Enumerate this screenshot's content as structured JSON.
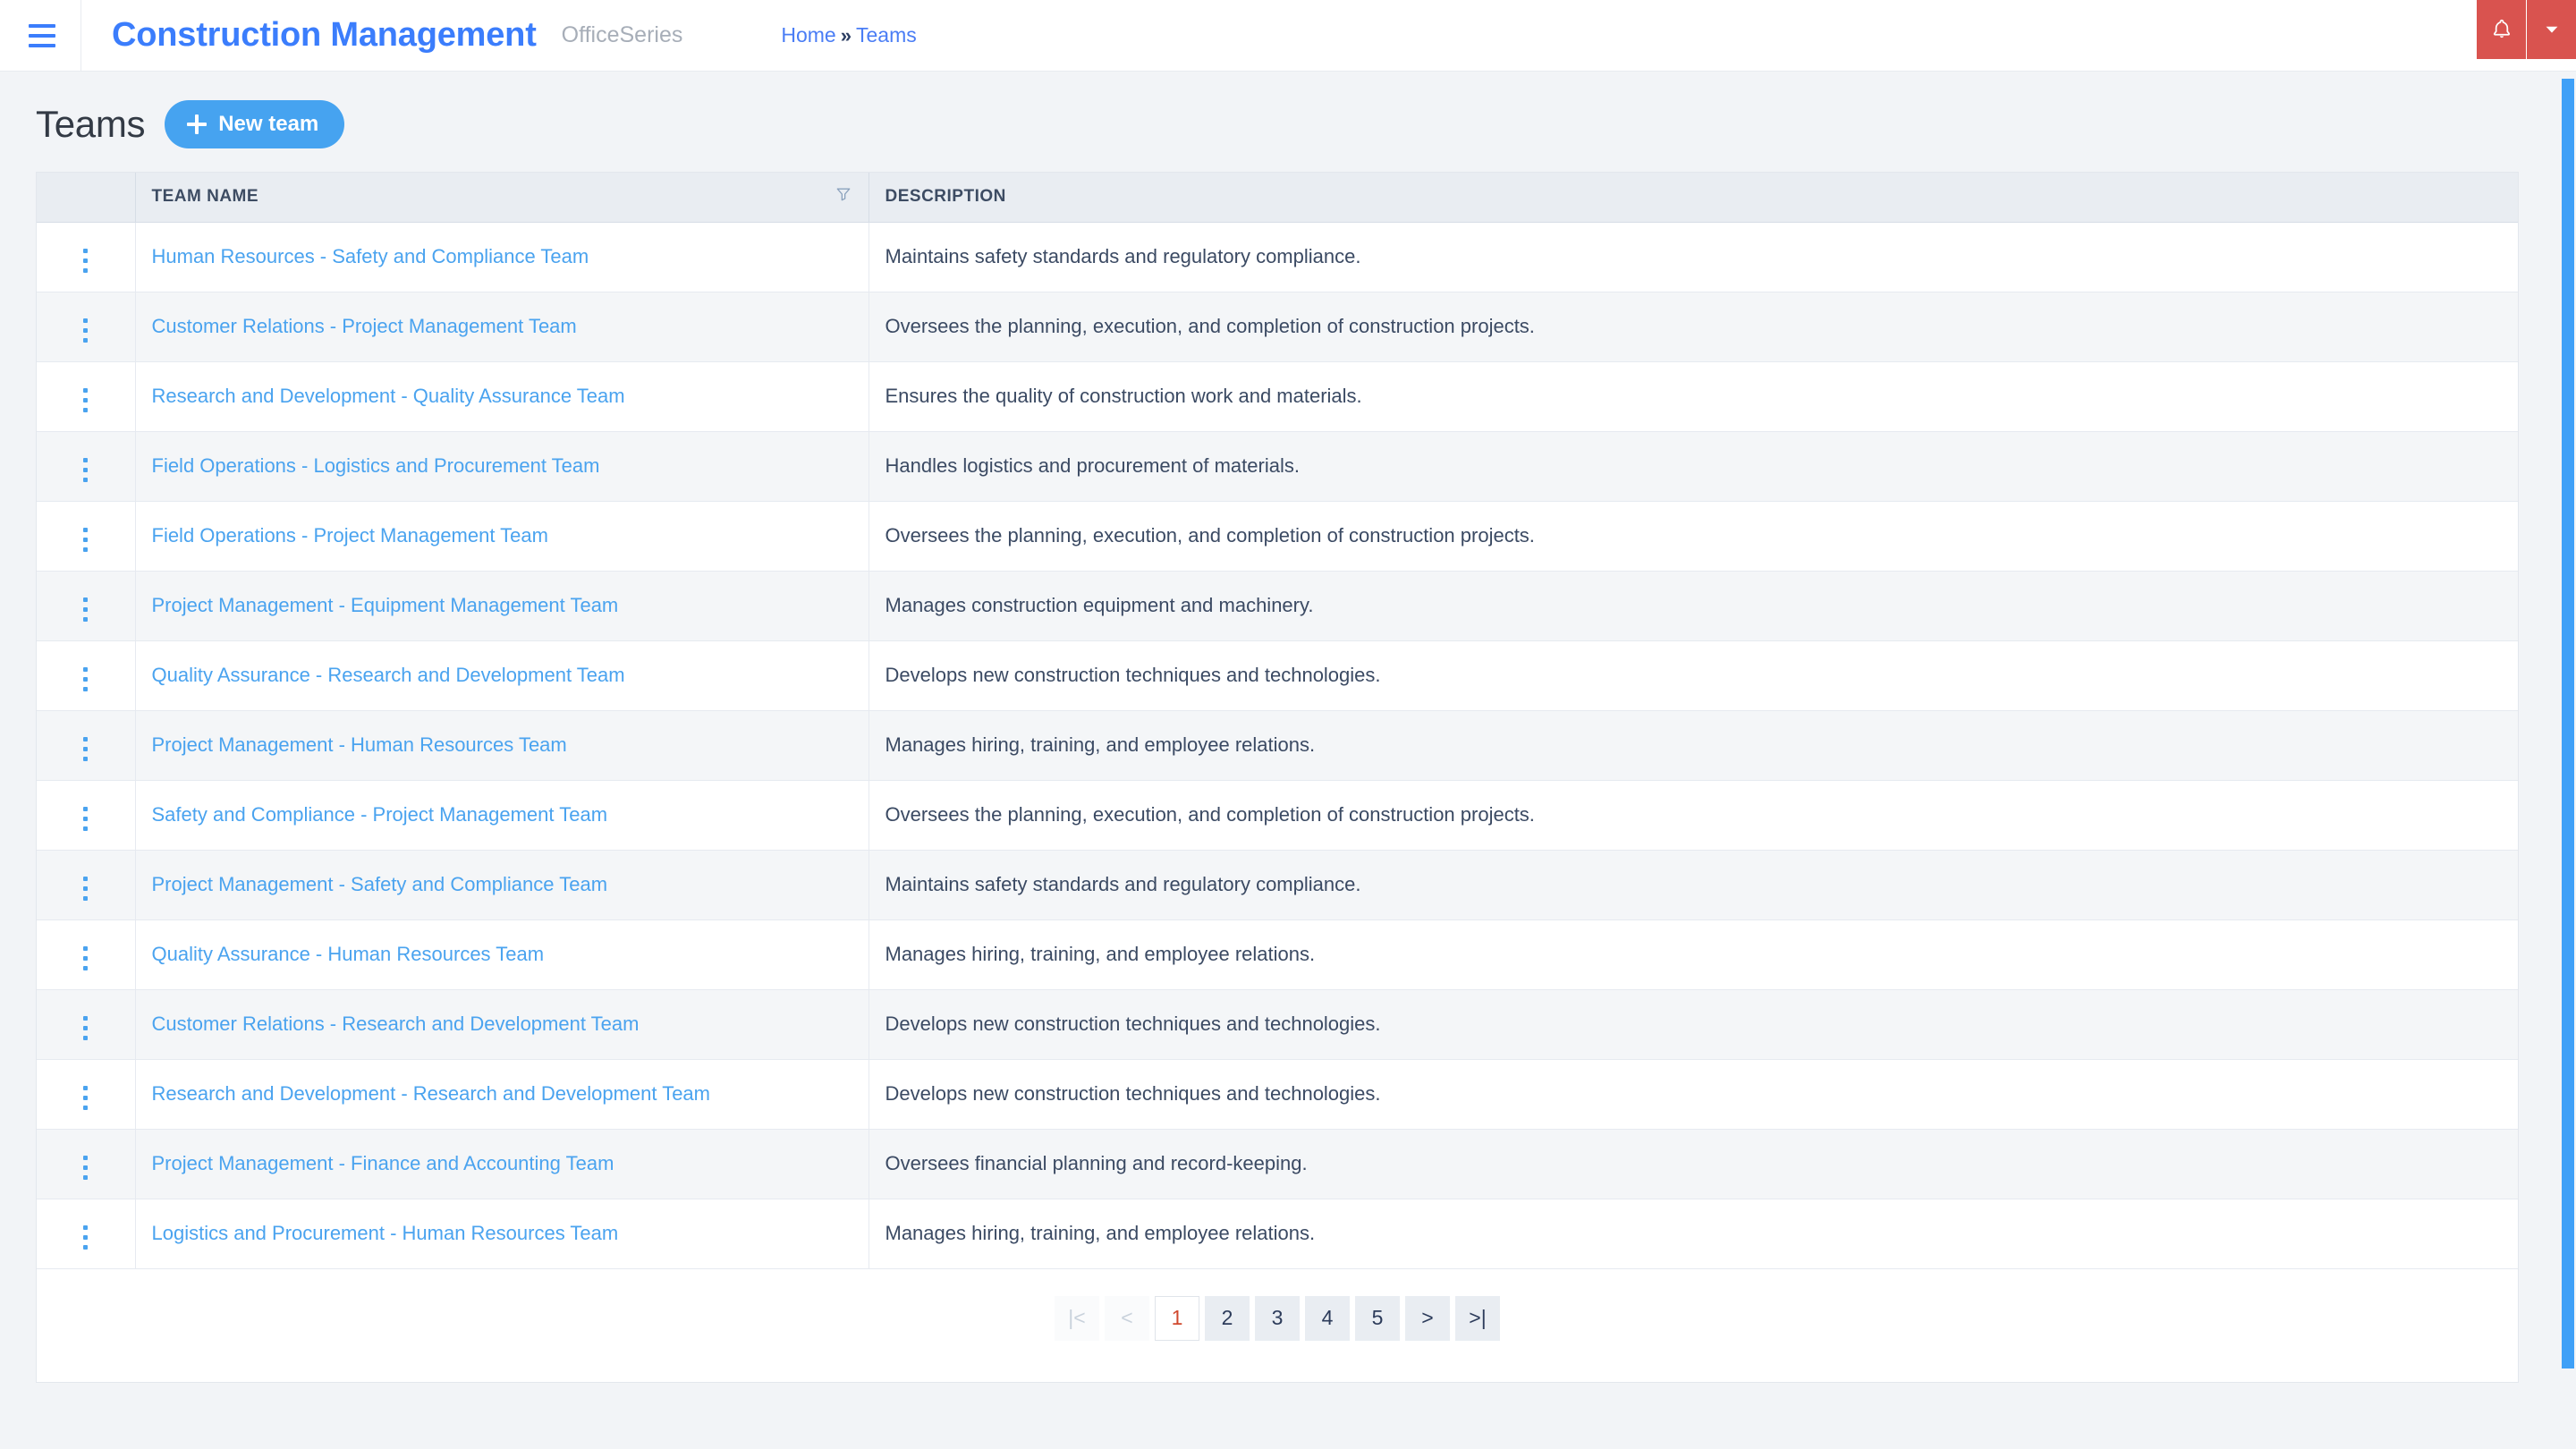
{
  "header": {
    "menu_icon": "hamburger-icon",
    "brand": "Construction Management",
    "brand_sub": "OfficeSeries",
    "breadcrumb": {
      "home": "Home",
      "separator": "»",
      "current": "Teams"
    },
    "notification_icon": "bell-icon",
    "dropdown_icon": "caret-down-icon",
    "accent_color": "#3b7dfc",
    "alert_color": "#d9534f"
  },
  "page": {
    "title": "Teams",
    "new_button_label": "New team",
    "new_button_icon": "plus-icon",
    "new_button_color": "#46a3f0"
  },
  "table": {
    "columns": [
      {
        "key": "actions",
        "label": ""
      },
      {
        "key": "name",
        "label": "TEAM NAME",
        "filter_icon": "funnel-icon"
      },
      {
        "key": "description",
        "label": "DESCRIPTION"
      }
    ],
    "row_action_icon": "kebab-menu-icon",
    "link_color": "#4aa3ef",
    "rows": [
      {
        "name": "Human Resources - Safety and Compliance Team",
        "description": "Maintains safety standards and regulatory compliance."
      },
      {
        "name": "Customer Relations - Project Management Team",
        "description": "Oversees the planning, execution, and completion of construction projects."
      },
      {
        "name": "Research and Development - Quality Assurance Team",
        "description": "Ensures the quality of construction work and materials."
      },
      {
        "name": "Field Operations - Logistics and Procurement Team",
        "description": "Handles logistics and procurement of materials."
      },
      {
        "name": "Field Operations - Project Management Team",
        "description": "Oversees the planning, execution, and completion of construction projects."
      },
      {
        "name": "Project Management - Equipment Management Team",
        "description": "Manages construction equipment and machinery."
      },
      {
        "name": "Quality Assurance - Research and Development Team",
        "description": "Develops new construction techniques and technologies."
      },
      {
        "name": "Project Management - Human Resources Team",
        "description": "Manages hiring, training, and employee relations."
      },
      {
        "name": "Safety and Compliance - Project Management Team",
        "description": "Oversees the planning, execution, and completion of construction projects."
      },
      {
        "name": "Project Management - Safety and Compliance Team",
        "description": "Maintains safety standards and regulatory compliance."
      },
      {
        "name": "Quality Assurance - Human Resources Team",
        "description": "Manages hiring, training, and employee relations."
      },
      {
        "name": "Customer Relations - Research and Development Team",
        "description": "Develops new construction techniques and technologies."
      },
      {
        "name": "Research and Development - Research and Development Team",
        "description": "Develops new construction techniques and technologies."
      },
      {
        "name": "Project Management - Finance and Accounting Team",
        "description": "Oversees financial planning and record-keeping."
      },
      {
        "name": "Logistics and Procurement - Human Resources Team",
        "description": "Manages hiring, training, and employee relations."
      }
    ]
  },
  "pagination": {
    "first_label": "|<",
    "prev_label": "<",
    "next_label": ">",
    "last_label": ">|",
    "pages": [
      "1",
      "2",
      "3",
      "4",
      "5"
    ],
    "current_page": "1",
    "active_color": "#d0492e"
  }
}
